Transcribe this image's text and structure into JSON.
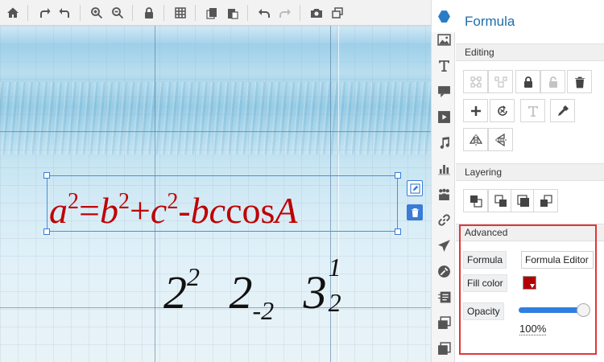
{
  "toolbar": {
    "buttons": [
      {
        "name": "home",
        "label": "Home"
      },
      {
        "name": "redo-arrow",
        "label": "Rotate forward"
      },
      {
        "name": "undo-arrow",
        "label": "Rotate back"
      },
      {
        "name": "zoom-in",
        "label": "Zoom in"
      },
      {
        "name": "zoom-out",
        "label": "Zoom out"
      },
      {
        "name": "lock",
        "label": "Lock"
      },
      {
        "name": "grid",
        "label": "Grid"
      },
      {
        "name": "copy",
        "label": "Copy"
      },
      {
        "name": "paste",
        "label": "Paste"
      },
      {
        "name": "undo",
        "label": "Undo"
      },
      {
        "name": "redo",
        "label": "Redo"
      },
      {
        "name": "camera",
        "label": "Screenshot"
      },
      {
        "name": "window",
        "label": "Window"
      }
    ]
  },
  "canvas": {
    "formula_main": {
      "a": "a",
      "a_exp": "2",
      "eq": "=",
      "b": "b",
      "b_exp": "2",
      "plus": "+",
      "c": "c",
      "c_exp": "2",
      "minus": "-",
      "bc": "bc",
      "cos": "cos",
      "A": "A",
      "color": "#c00000"
    },
    "formula_second": {
      "t1_base": "2",
      "t1_sup": "2",
      "t2_base": "2",
      "t2_sub": "-2",
      "t3_base": "3",
      "t3_sup": "1",
      "t3_sub": "2"
    }
  },
  "rail": {
    "items": [
      "formula-icon",
      "image-icon",
      "text-icon",
      "shape-icon",
      "video-icon",
      "music-icon",
      "chart-icon",
      "people-icon",
      "link-icon",
      "plane-icon",
      "tool-icon",
      "caption-icon",
      "photos-icon",
      "layers-icon"
    ]
  },
  "panel": {
    "title": "Formula",
    "sections": {
      "editing": "Editing",
      "layering": "Layering",
      "advanced": "Advanced"
    },
    "advanced": {
      "formula_label": "Formula",
      "formula_value": "Formula Editor",
      "fill_label": "Fill color",
      "fill_color": "#b30000",
      "opacity_label": "Opacity",
      "opacity_value": "100%",
      "opacity_level": 1.0
    }
  },
  "colors": {
    "accent": "#1e6fa8",
    "selection": "#3a7bd5",
    "highlight_border": "#e0363a"
  }
}
